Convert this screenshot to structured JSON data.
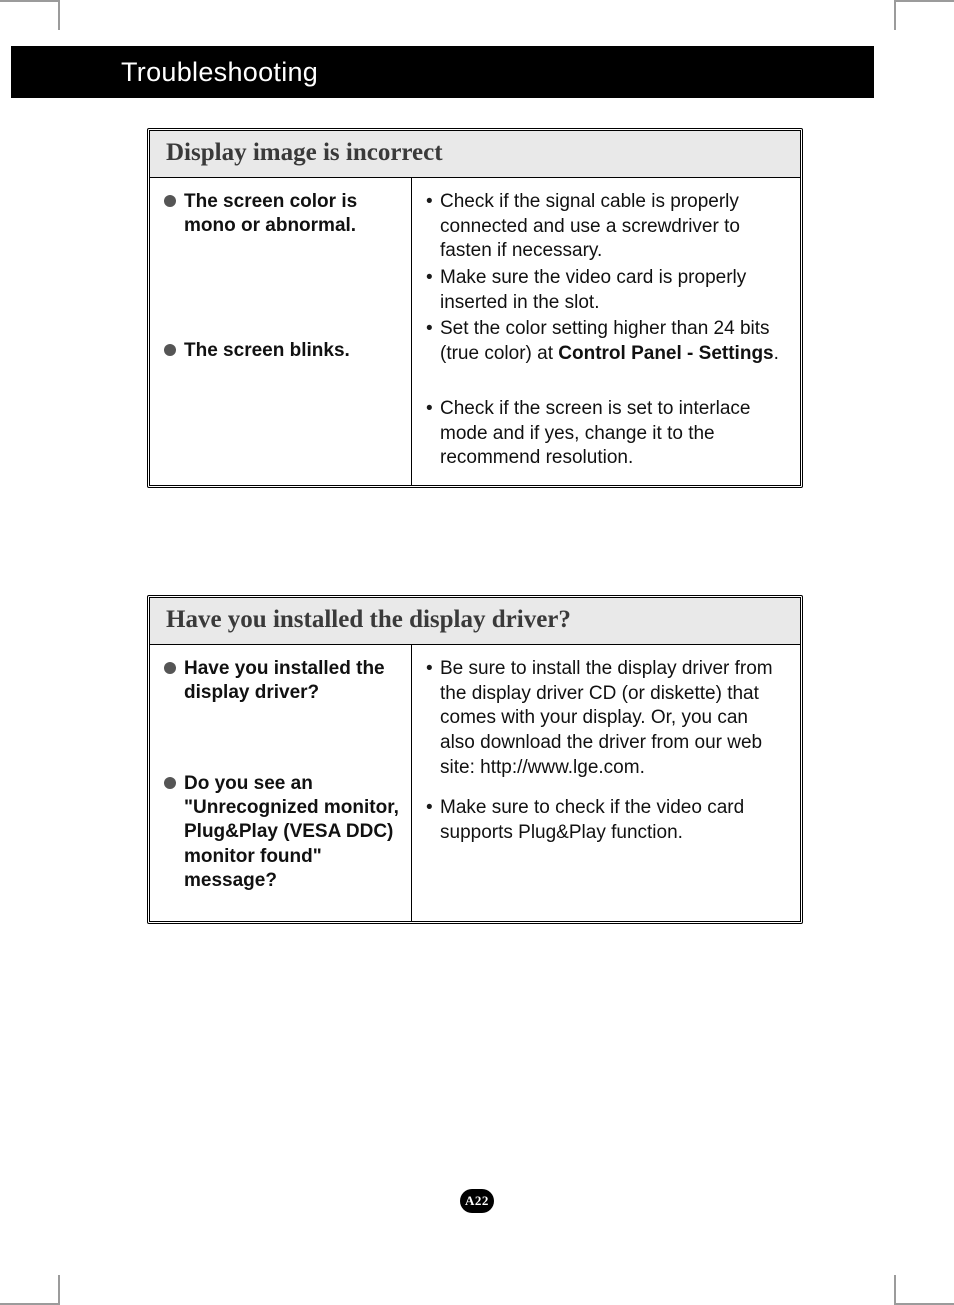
{
  "header": {
    "title": "Troubleshooting"
  },
  "sections": [
    {
      "title": "Display image is incorrect",
      "rows": [
        {
          "symptom": "The screen color is mono or abnormal.",
          "solutions": [
            {
              "text": "Check if the signal cable is properly connected and use a screwdriver to fasten if necessary."
            },
            {
              "text": "Make sure the video card is properly inserted in the slot."
            },
            {
              "prefix": "Set the color setting higher than 24 bits (true color) at ",
              "bold": "Control Panel - Settings",
              "suffix": "."
            }
          ]
        },
        {
          "symptom": "The screen blinks.",
          "solutions": [
            {
              "text": "Check if the screen is set to interlace mode and if yes, change it to the recommend resolution."
            }
          ]
        }
      ]
    },
    {
      "title": "Have you installed the display driver?",
      "rows": [
        {
          "symptom": "Have you installed the display driver?",
          "solutions": [
            {
              "text": "Be sure to install the display driver from the display driver CD (or diskette) that comes with your display. Or, you can also download the driver from our web site: http://www.lge.com."
            }
          ]
        },
        {
          "symptom": "Do you see an \"Unrecognized monitor, Plug&Play (VESA DDC) monitor found\" message?",
          "solutions": [
            {
              "text": "Make sure to check if the video card supports Plug&Play function."
            }
          ]
        }
      ]
    }
  ],
  "page_number": "A22"
}
